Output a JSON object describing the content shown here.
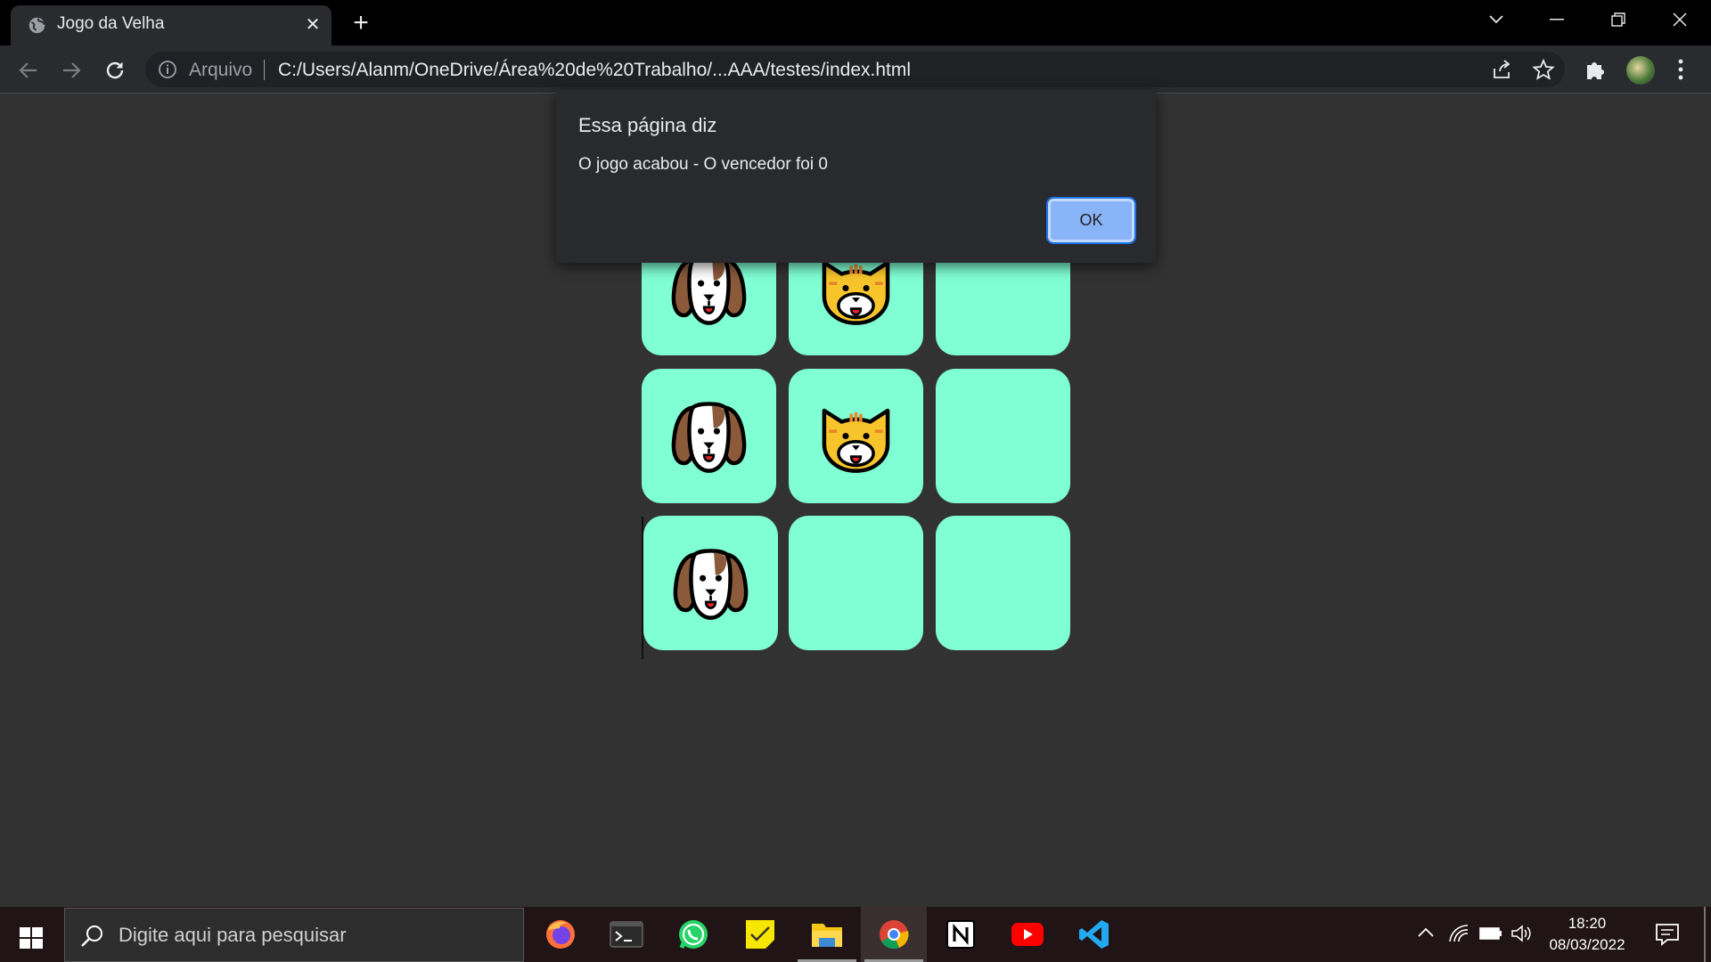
{
  "browser": {
    "tab_title": "Jogo da Velha",
    "new_tab": "+",
    "scheme_label": "Arquivo",
    "url": "C:/Users/Alanm/OneDrive/Área%20de%20Trabalho/...AAA/testes/index.html"
  },
  "dialog": {
    "title": "Essa página diz",
    "message": "O jogo acabou - O vencedor foi 0",
    "ok_label": "OK"
  },
  "board": {
    "cells": [
      {
        "mark": "dog"
      },
      {
        "mark": "cat"
      },
      {
        "mark": ""
      },
      {
        "mark": "dog"
      },
      {
        "mark": "cat"
      },
      {
        "mark": ""
      },
      {
        "mark": "dog"
      },
      {
        "mark": ""
      },
      {
        "mark": ""
      }
    ],
    "cell_color": "#80ffd4"
  },
  "taskbar": {
    "search_placeholder": "Digite aqui para pesquisar",
    "apps": [
      "firefox-icon",
      "terminal-icon",
      "whatsapp-icon",
      "sticky-notes-icon",
      "file-explorer-icon",
      "chrome-icon",
      "notion-icon",
      "youtube-icon",
      "vscode-icon"
    ],
    "time": "18:20",
    "date": "08/03/2022"
  }
}
